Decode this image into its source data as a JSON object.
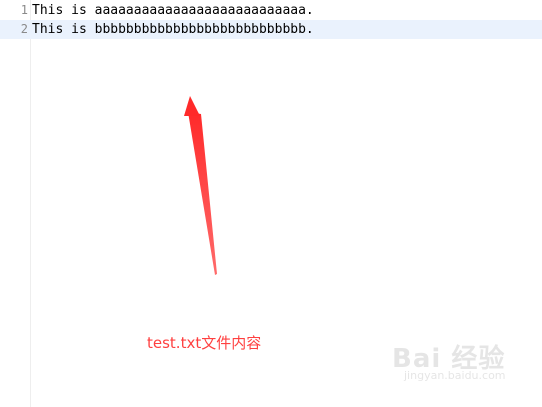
{
  "editor": {
    "lines": [
      {
        "number": "1",
        "text": "This is aaaaaaaaaaaaaaaaaaaaaaaaaaa."
      },
      {
        "number": "2",
        "text": "This is bbbbbbbbbbbbbbbbbbbbbbbbbbb."
      }
    ],
    "active_line": 2
  },
  "annotation": {
    "caption": "test.txt文件内容",
    "arrow_color": "#ff3b3b",
    "caption_color": "#ff4040"
  },
  "watermark": {
    "main": "Bai 经验",
    "sub": "jingyan.baidu.com"
  }
}
